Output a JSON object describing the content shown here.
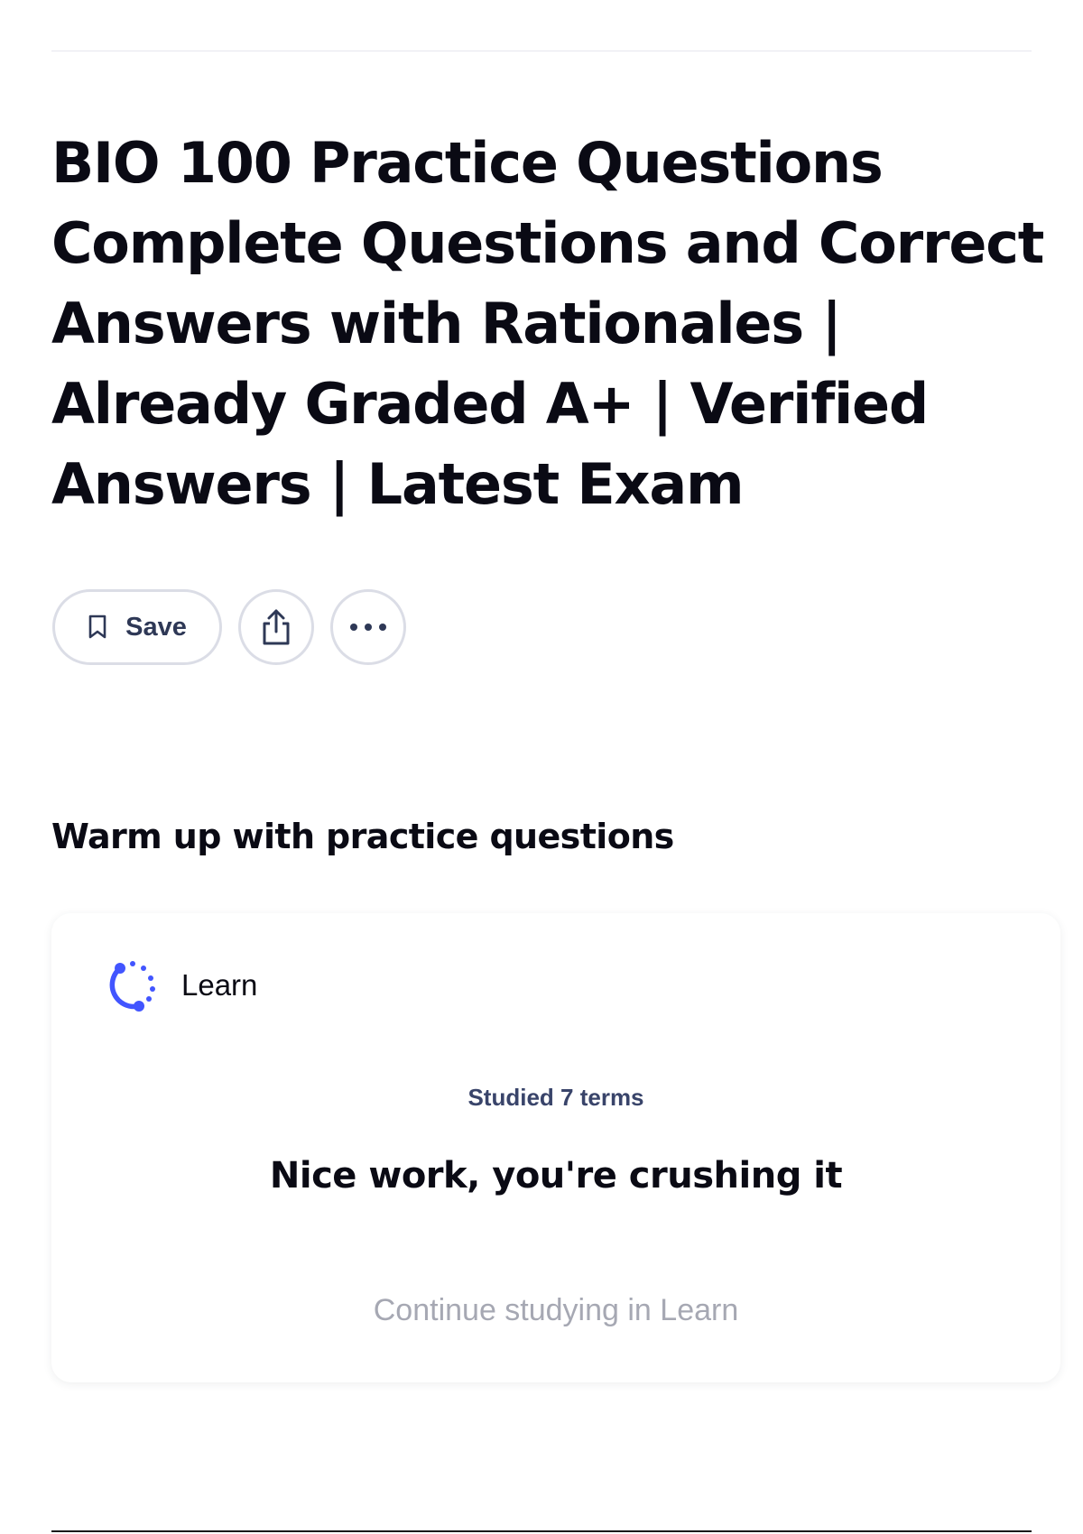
{
  "header": {
    "title": "BIO 100 Practice Questions Complete Questions and Correct Answers with Rationales | Already Graded A+ | Verified Answers | Latest Exam"
  },
  "actions": {
    "save_label": "Save",
    "save_icon": "bookmark-icon",
    "share_icon": "share-icon",
    "more_icon": "more-options-icon"
  },
  "practice": {
    "heading": "Warm up with practice questions",
    "card": {
      "label": "Learn",
      "icon": "learn-progress-icon",
      "studied_text": "Studied 7 terms",
      "message": "Nice work, you're crushing it",
      "continue_label": "Continue studying in Learn"
    }
  },
  "colors": {
    "accent": "#4255ff",
    "text": "#0a092d",
    "muted": "#a6a8b3",
    "border": "#dbdde6"
  }
}
